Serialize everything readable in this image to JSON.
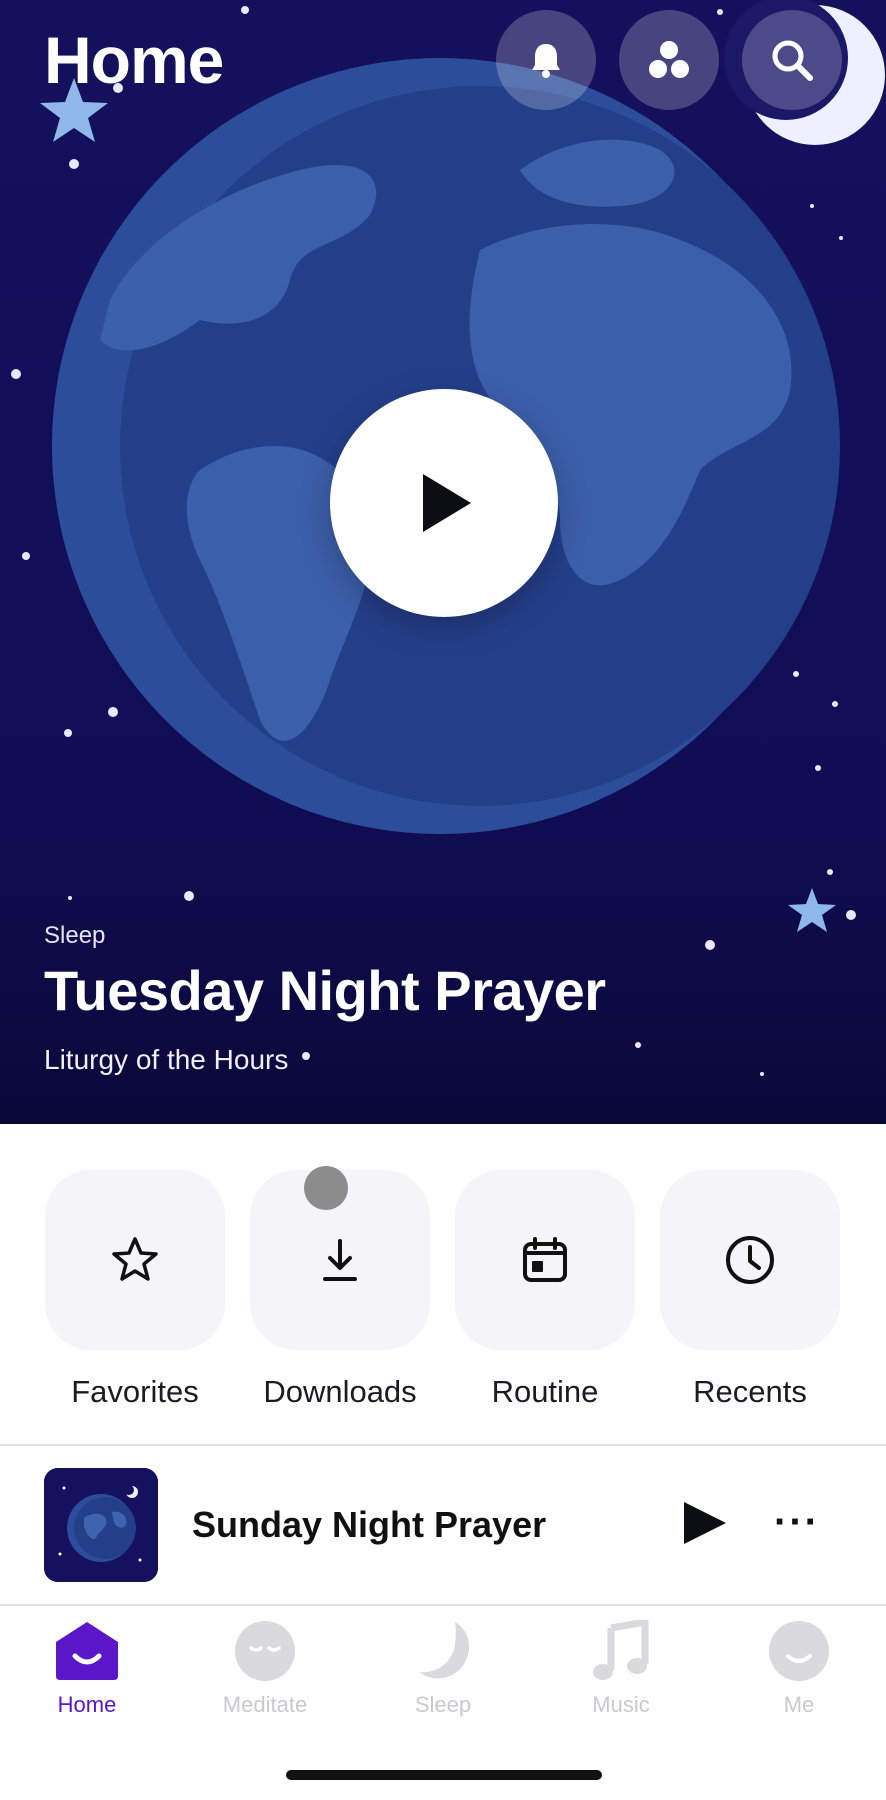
{
  "header": {
    "title": "Home"
  },
  "hero": {
    "category": "Sleep",
    "title": "Tuesday Night Prayer",
    "subtitle": "Liturgy of the Hours"
  },
  "quick_actions": [
    {
      "label": "Favorites",
      "icon": "star-icon"
    },
    {
      "label": "Downloads",
      "icon": "download-icon"
    },
    {
      "label": "Routine",
      "icon": "calendar-icon"
    },
    {
      "label": "Recents",
      "icon": "clock-icon"
    }
  ],
  "mini_player": {
    "title": "Sunday Night Prayer",
    "more": "···"
  },
  "tabs": [
    {
      "label": "Home",
      "icon": "home-icon",
      "active": true
    },
    {
      "label": "Meditate",
      "icon": "meditate-icon",
      "active": false
    },
    {
      "label": "Sleep",
      "icon": "moon-icon",
      "active": false
    },
    {
      "label": "Music",
      "icon": "music-note-icon",
      "active": false
    },
    {
      "label": "Me",
      "icon": "profile-icon",
      "active": false
    }
  ],
  "colors": {
    "hero_bg": "#14105c",
    "accent": "#5a16c8",
    "tab_inactive": "#c9c9d0"
  }
}
